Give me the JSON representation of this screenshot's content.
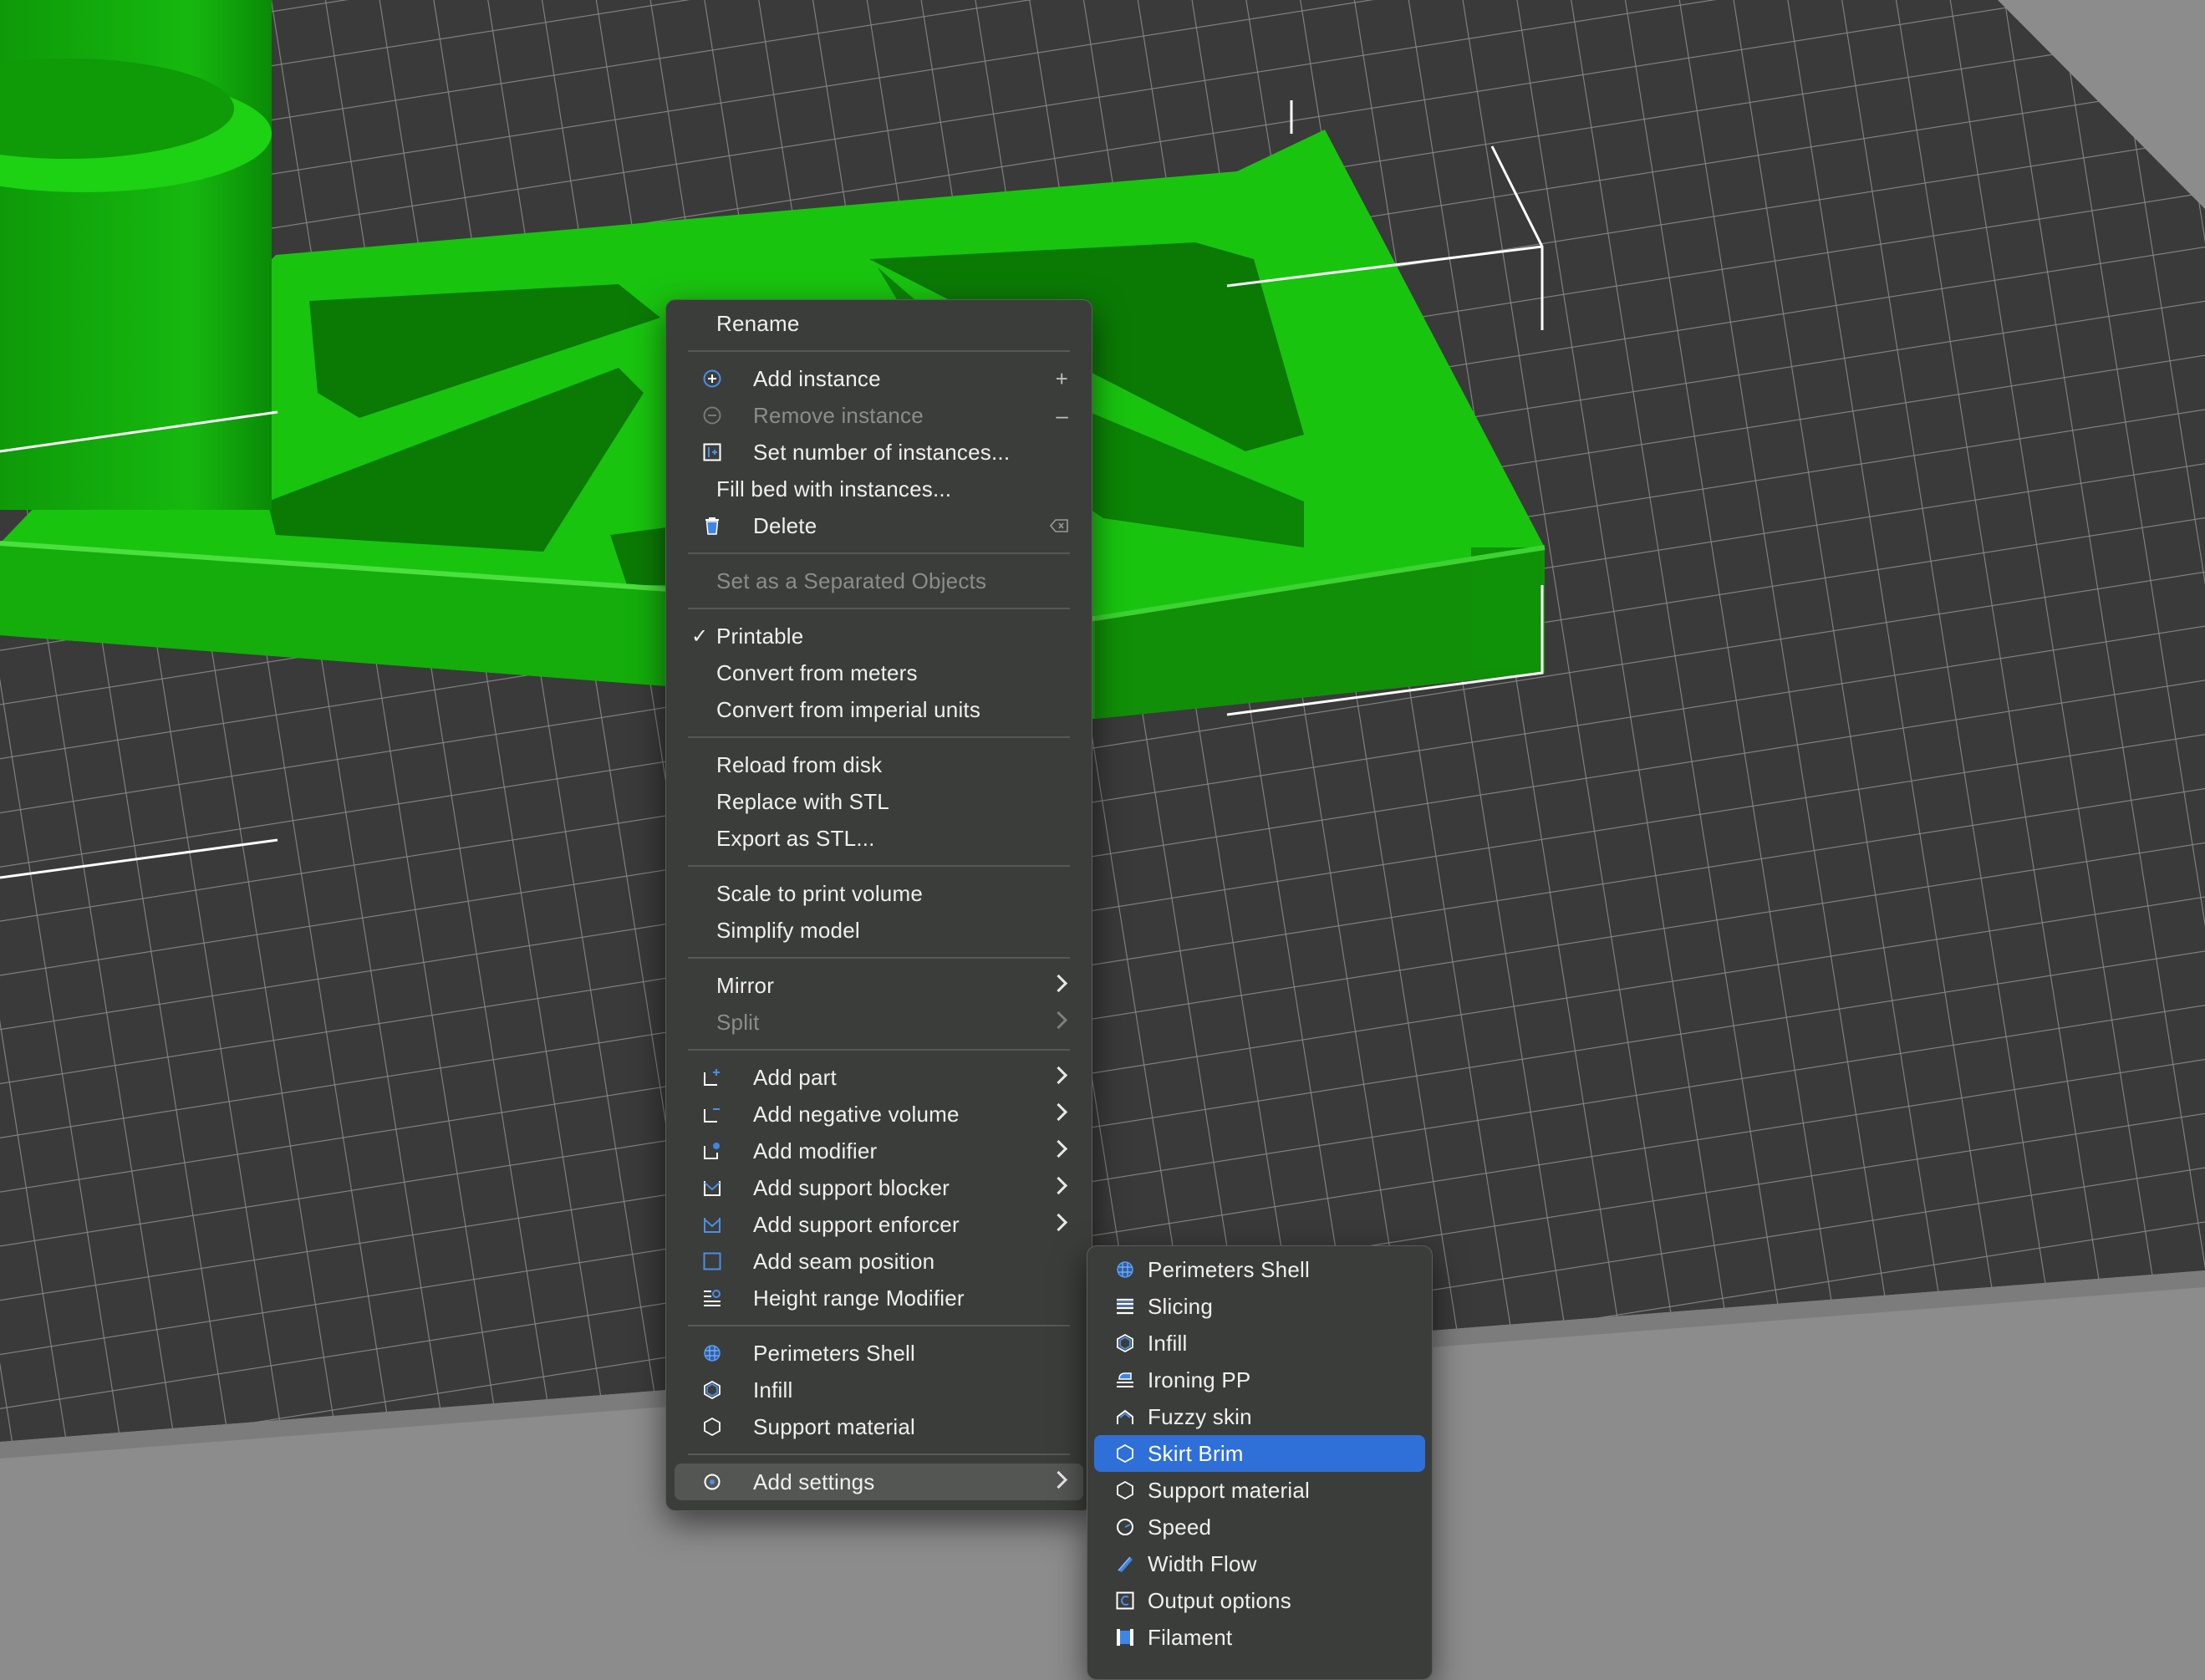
{
  "colors": {
    "model_green": "#19c40f",
    "grid_dark": "#3a3a3a",
    "grid_line": "#8a8a8a",
    "menu_bg": "#3b3d3a",
    "highlight": "#2f6fd8"
  },
  "context_menu": {
    "rename": "Rename",
    "add_instance": "Add instance",
    "add_instance_shortcut": "+",
    "remove_instance": "Remove instance",
    "remove_instance_shortcut": "–",
    "set_number": "Set number of instances...",
    "fill_bed": "Fill bed with instances...",
    "delete": "Delete",
    "set_separated": "Set as a Separated Objects",
    "printable": "Printable",
    "printable_check": "✓",
    "convert_meters": "Convert from meters",
    "convert_imperial": "Convert from imperial units",
    "reload": "Reload from disk",
    "replace_stl": "Replace with STL",
    "export_stl": "Export as STL...",
    "scale_volume": "Scale to print volume",
    "simplify": "Simplify model",
    "mirror": "Mirror",
    "split": "Split",
    "add_part": "Add part",
    "add_negative": "Add negative volume",
    "add_modifier": "Add modifier",
    "add_blocker": "Add support blocker",
    "add_enforcer": "Add support enforcer",
    "add_seam": "Add seam position",
    "height_range": "Height range Modifier",
    "perimeters_shell": "Perimeters  Shell",
    "infill": "Infill",
    "support_material": "Support material",
    "add_settings": "Add settings"
  },
  "settings_submenu": {
    "perimeters_shell": "Perimeters  Shell",
    "slicing": "Slicing",
    "infill": "Infill",
    "ironing": "Ironing PP",
    "fuzzy_skin": "Fuzzy skin",
    "skirt_brim": "Skirt  Brim",
    "support_material": "Support material",
    "speed": "Speed",
    "width_flow": "Width  Flow",
    "output_options": "Output options",
    "filament": "Filament"
  }
}
